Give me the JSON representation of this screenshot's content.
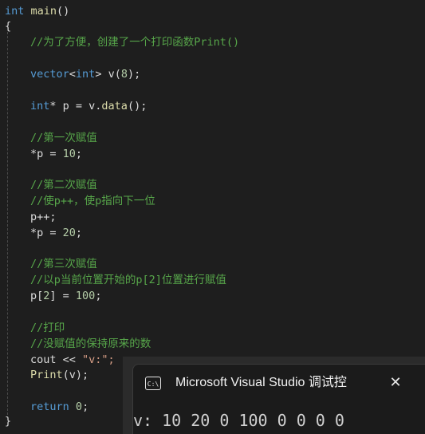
{
  "code": {
    "l1_int": "int",
    "l1_main": "main",
    "l1_paren": "()",
    "l2": "{",
    "l3": "//为了方便，创建了一个打印函数Print()",
    "l5_vector": "vector",
    "l5_lt": "<",
    "l5_int": "int",
    "l5_rest": "> v(",
    "l5_num": "8",
    "l5_end": ");",
    "l7_int": "int",
    "l7_mid": "* p = v.",
    "l7_data": "data",
    "l7_end": "();",
    "l9": "//第一次赋值",
    "l10_a": "*p = ",
    "l10_num": "10",
    "l10_end": ";",
    "l12": "//第二次赋值",
    "l13": "//使p++，使p指向下一位",
    "l14": "p++;",
    "l15_a": "*p = ",
    "l15_num": "20",
    "l15_end": ";",
    "l17": "//第三次赋值",
    "l18": "//以p当前位置开始的p[2]位置进行赋值",
    "l19_a": "p[",
    "l19_idx": "2",
    "l19_b": "] = ",
    "l19_num": "100",
    "l19_end": ";",
    "l21": "//打印",
    "l22": "//没赋值的保持原来的数",
    "l23_a": "cout << ",
    "l23_str": "\"v:\";",
    "l24_fn": "Print",
    "l24_end": "(v);",
    "l26_kw": "return",
    "l26_sp": " ",
    "l26_num": "0",
    "l26_end": ";",
    "l27": "}"
  },
  "console": {
    "icon": "C:\\",
    "title": "Microsoft Visual Studio 调试控",
    "close": "✕",
    "output": "v: 10 20 0 100 0 0 0 0"
  },
  "colors": {
    "background": "#1e1e1e",
    "keyword": "#569cd6",
    "comment": "#57a64a",
    "function": "#dcdcaa",
    "number": "#b5cea8",
    "string": "#d69d85",
    "text": "#dcdcdc"
  },
  "icons": [
    "terminal-icon",
    "close-icon"
  ]
}
